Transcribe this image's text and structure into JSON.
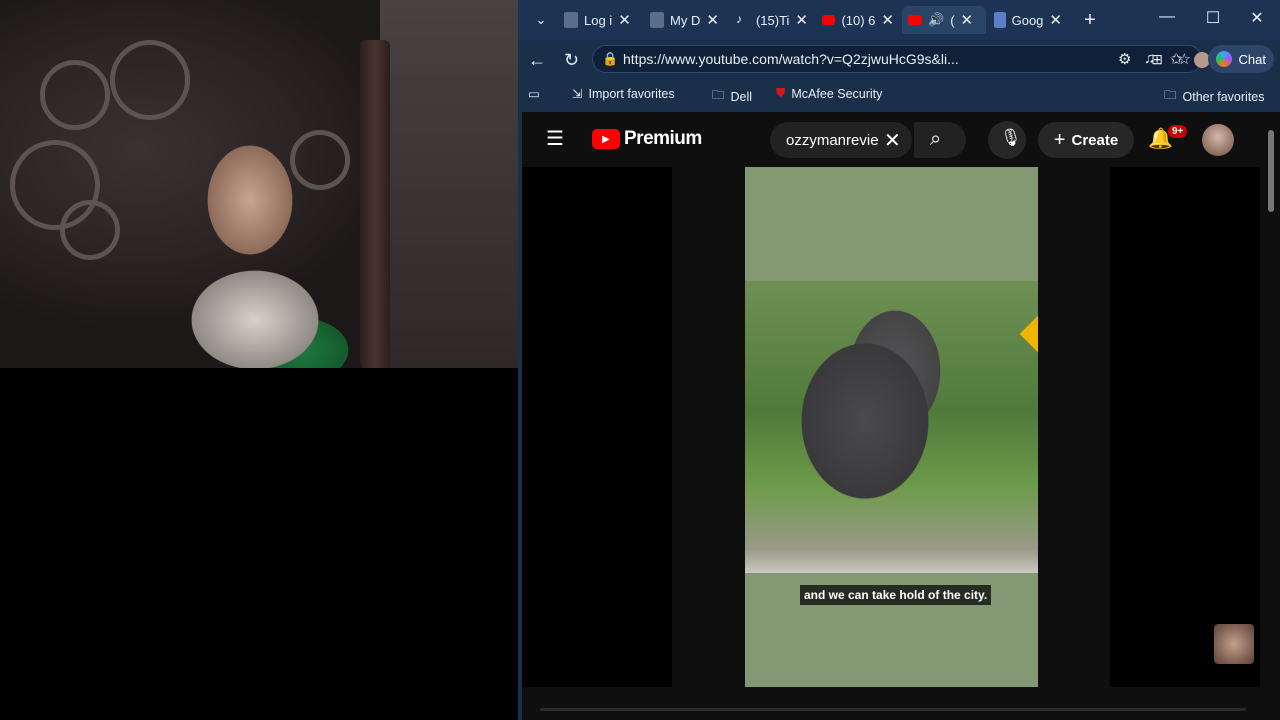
{
  "tabs": [
    {
      "label": "Log i",
      "icon": "document-icon"
    },
    {
      "label": "My D",
      "icon": "document-icon"
    },
    {
      "label": "(15)Ti",
      "icon": "tiktok-icon"
    },
    {
      "label": "(10) 6",
      "icon": "youtube-icon"
    },
    {
      "label": "(",
      "icon": "youtube-icon",
      "active": true
    },
    {
      "label": "Goog",
      "icon": "document-icon"
    }
  ],
  "address": {
    "url": "https://www.youtube.com/watch?v=Q2zjwuHcG9s&li..."
  },
  "chat_label": "Chat",
  "favorites": {
    "import": "Import favorites",
    "dell": "Dell",
    "mcafee": "McAfee Security",
    "other": "Other favorites"
  },
  "youtube": {
    "logo_text": "Premium",
    "search_query": "ozzymanrevie",
    "create_label": "Create",
    "notification_count": "9+",
    "caption": "and we can take hold of the city."
  },
  "colors": {
    "browser_bg": "#1a2f4a",
    "youtube_red": "#ff0000",
    "video_bg": "#839873"
  }
}
